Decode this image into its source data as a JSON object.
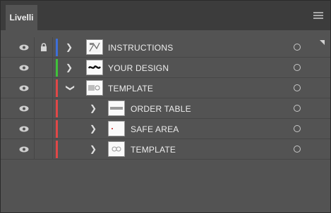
{
  "panel": {
    "tab_label": "Livelli",
    "menu_icon": "hamburger-menu-icon"
  },
  "layers": [
    {
      "name": "INSTRUCTIONS",
      "visible": true,
      "locked": true,
      "color": "#3e6fd8",
      "expanded": false,
      "indent": 0
    },
    {
      "name": "YOUR DESIGN",
      "visible": true,
      "locked": false,
      "color": "#3fc23a",
      "expanded": false,
      "indent": 0
    },
    {
      "name": "TEMPLATE",
      "visible": true,
      "locked": false,
      "color": "#e04848",
      "expanded": true,
      "indent": 0
    },
    {
      "name": "ORDER TABLE",
      "visible": true,
      "locked": false,
      "color": "#e04848",
      "expanded": false,
      "indent": 1
    },
    {
      "name": "SAFE AREA",
      "visible": true,
      "locked": false,
      "color": "#e04848",
      "expanded": false,
      "indent": 1
    },
    {
      "name": "TEMPLATE",
      "visible": true,
      "locked": false,
      "color": "#e04848",
      "expanded": false,
      "indent": 1
    }
  ]
}
